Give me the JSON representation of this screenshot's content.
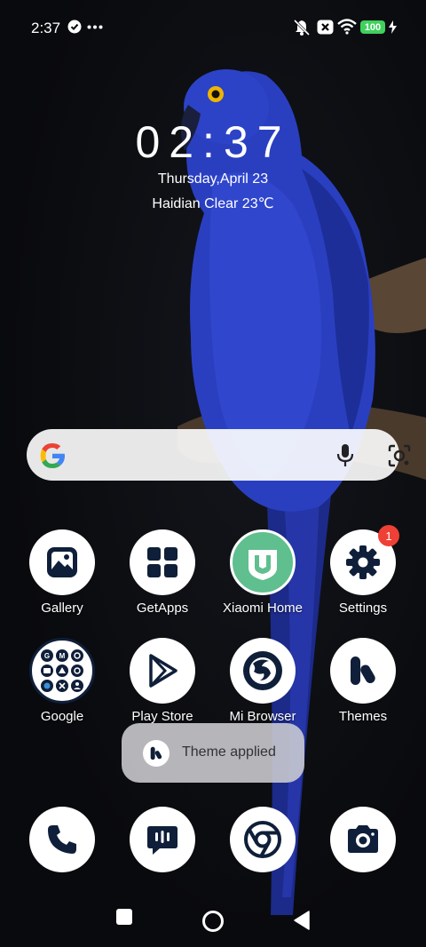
{
  "status_bar": {
    "time": "2:37",
    "battery": "100",
    "icons": [
      "check-circle-icon",
      "more-dots-icon",
      "mute-icon",
      "sim-off-icon",
      "wifi-icon",
      "battery-icon",
      "charging-icon"
    ]
  },
  "clock_widget": {
    "time": "02:37",
    "date": "Thursday,April 23",
    "weather": "Haidian Clear 23℃"
  },
  "search": {
    "icons": [
      "google-logo-icon",
      "microphone-icon",
      "google-lens-icon"
    ]
  },
  "apps_row1": [
    {
      "label": "Gallery",
      "icon": "gallery-icon"
    },
    {
      "label": "GetApps",
      "icon": "getapps-icon"
    },
    {
      "label": "Xiaomi Home",
      "icon": "xiaomi-home-icon"
    },
    {
      "label": "Settings",
      "icon": "gear-icon",
      "badge": "1"
    }
  ],
  "apps_row2": [
    {
      "label": "Google",
      "icon": "google-folder-icon"
    },
    {
      "label": "Play Store",
      "icon": "play-store-icon"
    },
    {
      "label": "Mi Browser",
      "icon": "mi-browser-icon"
    },
    {
      "label": "Themes",
      "icon": "themes-icon"
    }
  ],
  "dock": [
    {
      "icon": "phone-icon"
    },
    {
      "icon": "messages-icon"
    },
    {
      "icon": "chrome-icon"
    },
    {
      "icon": "camera-icon"
    }
  ],
  "toast": {
    "text": "Theme applied",
    "icon": "themes-icon"
  },
  "nav": {
    "icons": [
      "recents-square-icon",
      "home-circle-icon",
      "back-triangle-icon"
    ]
  },
  "colors": {
    "accent_green": "#3fd15c",
    "badge_red": "#ef4035",
    "xiaomi_home_green": "#5fbf8f",
    "icon_dark": "#0f1f3a",
    "parrot_blue": "#2a3fc0"
  }
}
